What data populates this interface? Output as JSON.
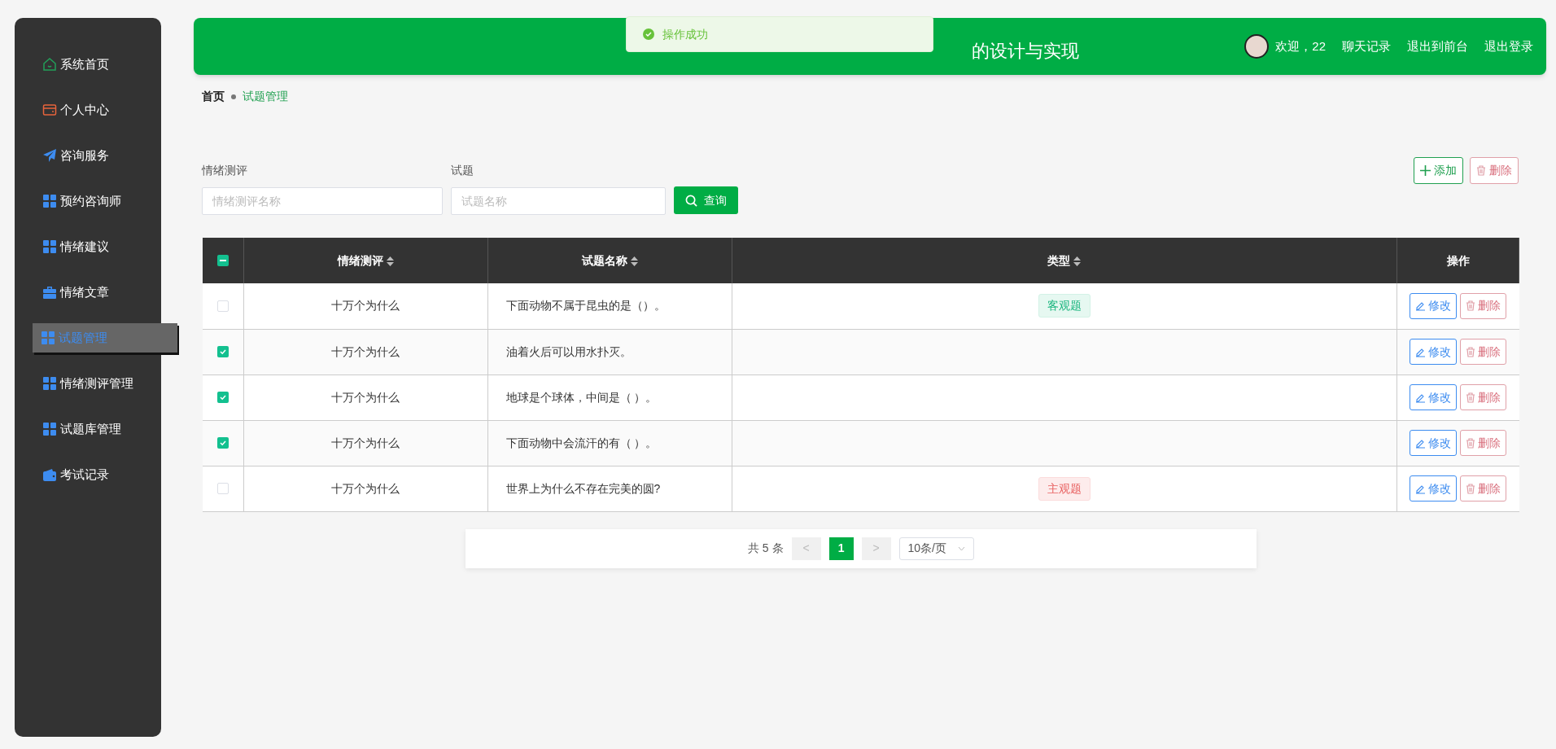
{
  "sidebar": {
    "items": [
      {
        "label": "系统首页",
        "selected": false
      },
      {
        "label": "个人中心",
        "selected": false
      },
      {
        "label": "咨询服务",
        "selected": false
      },
      {
        "label": "预约咨询师",
        "selected": false
      },
      {
        "label": "情绪建议",
        "selected": false
      },
      {
        "label": "情绪文章",
        "selected": false
      },
      {
        "label": "试题管理",
        "selected": true
      },
      {
        "label": "情绪测评管理",
        "selected": false
      },
      {
        "label": "试题库管理",
        "selected": false
      },
      {
        "label": "考试记录",
        "selected": false
      }
    ]
  },
  "header": {
    "title": "的设计与实现",
    "welcome": "欢迎，22",
    "links": [
      "聊天记录",
      "退出到前台",
      "退出登录"
    ]
  },
  "toast": {
    "message": "操作成功"
  },
  "breadcrumb": [
    "首页",
    "试题管理"
  ],
  "filters": [
    {
      "label": "情绪测评",
      "placeholder": "情绪测评名称"
    },
    {
      "label": "试题",
      "placeholder": "试题名称"
    }
  ],
  "search_button": "查询",
  "add_button": "添加",
  "delete_button": "删除",
  "table": {
    "select_all": {
      "checked": true,
      "indeterminate": true
    },
    "columns": [
      {
        "label": "情绪测评",
        "sortable": true
      },
      {
        "label": "试题名称",
        "sortable": true
      },
      {
        "label": "类型",
        "sortable": true
      },
      {
        "label": "操作",
        "sortable": false
      }
    ],
    "rows": [
      {
        "checked": false,
        "assessment": "十万个为什么",
        "question": "下面动物不属于昆虫的是（）。",
        "type": {
          "label": "客观题",
          "kind": "objective"
        },
        "actions": [
          "修改",
          "删除"
        ]
      },
      {
        "checked": true,
        "assessment": "十万个为什么",
        "question": "油着火后可以用水扑灭。",
        "actions": [
          "修改",
          "删除"
        ]
      },
      {
        "checked": true,
        "assessment": "十万个为什么",
        "question": "地球是个球体，中间是（ ）。",
        "actions": [
          "修改",
          "删除"
        ]
      },
      {
        "checked": true,
        "assessment": "十万个为什么",
        "question": "下面动物中会流汗的有（ ）。",
        "actions": [
          "修改",
          "删除"
        ]
      },
      {
        "checked": false,
        "assessment": "十万个为什么",
        "question": "世界上为什么不存在完美的圆?",
        "type": {
          "label": "主观题",
          "kind": "subjective"
        },
        "actions": [
          "修改",
          "删除"
        ]
      }
    ]
  },
  "pagination": {
    "total": "共 5 条",
    "prev": "<",
    "pages": [
      {
        "label": "1",
        "selected": true
      }
    ],
    "next": ">",
    "page_size": "10条/页"
  }
}
